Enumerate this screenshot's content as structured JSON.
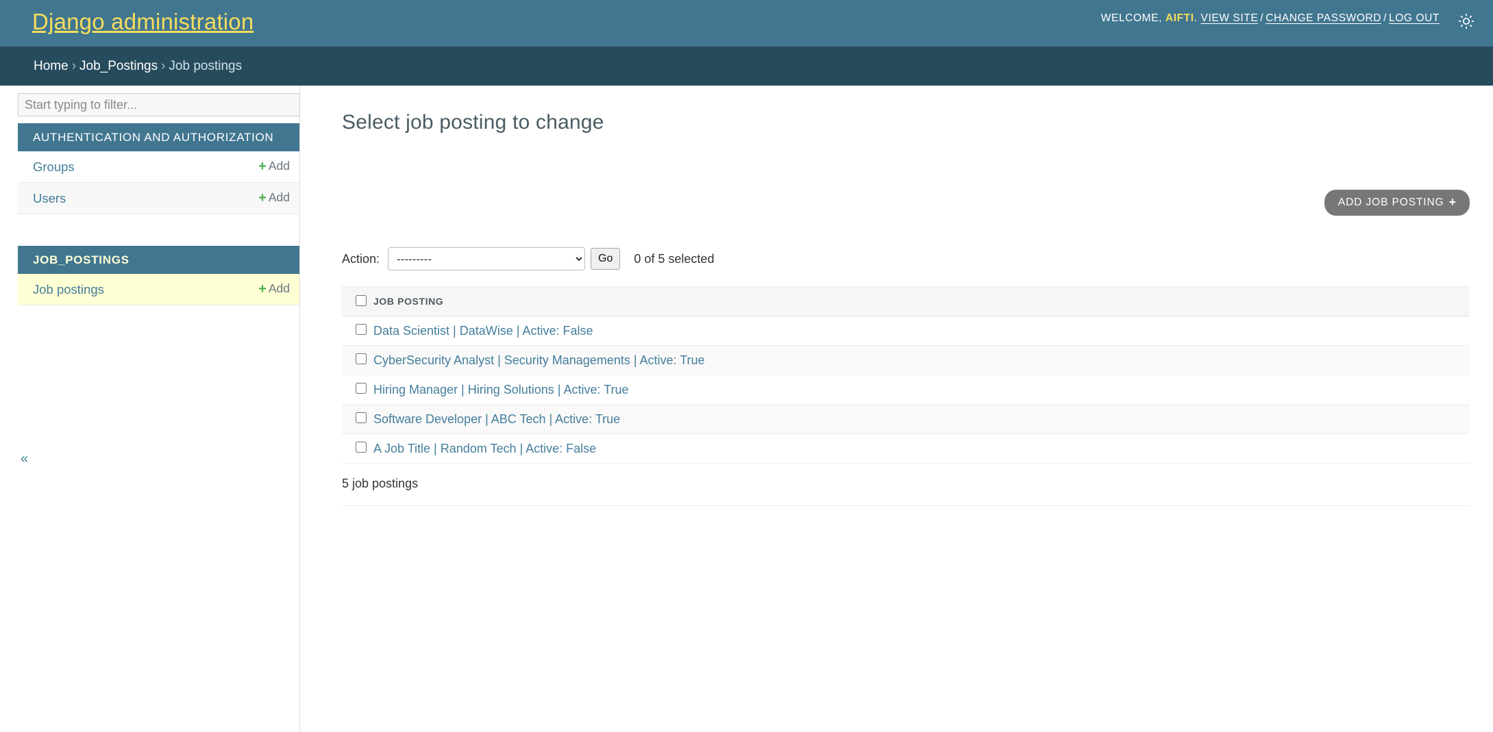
{
  "header": {
    "site_name": "Django administration",
    "welcome_prefix": "WELCOME,",
    "username": "AIFTI",
    "period": ".",
    "view_site": "VIEW SITE",
    "change_password": "CHANGE PASSWORD",
    "log_out": "LOG OUT",
    "sep": "/",
    "theme_icon": "sun-icon",
    "colors": {
      "header_bg": "#417690",
      "breadcrumb_bg": "#264b5d",
      "brand_text": "#f5dd5d",
      "link_blue": "#447e9b",
      "add_green": "#4caf50",
      "current_row": "#ffffd5"
    }
  },
  "breadcrumbs": {
    "home": "Home",
    "app": "Job_Postings",
    "model": "Job postings",
    "separator": "›"
  },
  "sidebar": {
    "filter_placeholder": "Start typing to filter...",
    "filter_value": "",
    "collapse_icon": "«",
    "apps": [
      {
        "caption": "AUTHENTICATION AND AUTHORIZATION",
        "current": false,
        "models": [
          {
            "name": "Groups",
            "add_label": "Add",
            "current": false
          },
          {
            "name": "Users",
            "add_label": "Add",
            "current": false
          }
        ]
      },
      {
        "caption": "JOB_POSTINGS",
        "current": true,
        "models": [
          {
            "name": "Job postings",
            "add_label": "Add",
            "current": true
          }
        ]
      }
    ]
  },
  "main": {
    "title": "Select job posting to change",
    "add_button": "ADD JOB POSTING",
    "add_button_icon": "plus-icon",
    "action_label": "Action:",
    "action_selected": "---------",
    "action_options": [
      "---------"
    ],
    "go_label": "Go",
    "selection_counter": "0 of 5 selected",
    "columns": [
      "JOB POSTING"
    ],
    "rows": [
      {
        "title": "Data Scientist | DataWise | Active: False"
      },
      {
        "title": "CyberSecurity Analyst | Security Managements | Active: True"
      },
      {
        "title": "Hiring Manager | Hiring Solutions | Active: True"
      },
      {
        "title": "Software Developer | ABC Tech | Active: True"
      },
      {
        "title": "A Job Title | Random Tech | Active: False"
      }
    ],
    "paginator": "5 job postings"
  }
}
